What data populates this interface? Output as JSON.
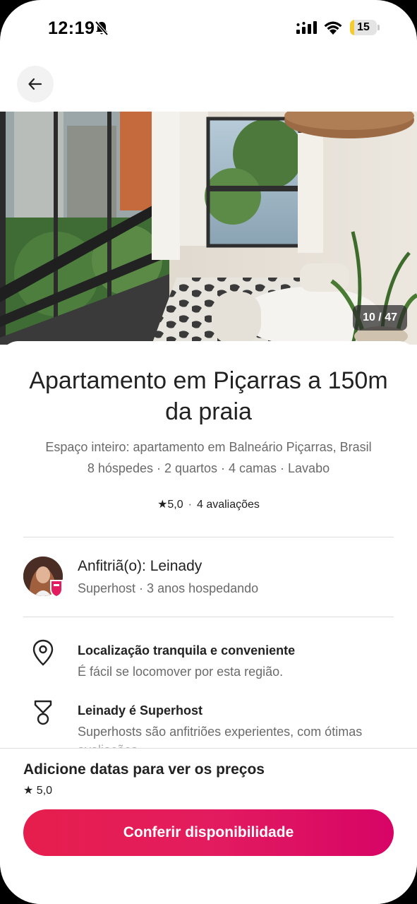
{
  "status_bar": {
    "time": "12:19",
    "battery_level": "15",
    "battery_fraction": 0.15,
    "icons": [
      "bell-off-icon",
      "signal-icon",
      "wifi-icon",
      "battery-icon"
    ]
  },
  "nav": {
    "back_icon": "arrow-left-icon"
  },
  "photo": {
    "counter": "10 / 47"
  },
  "listing": {
    "title": "Apartamento em Piçarras a 150m da praia",
    "subtitle_line1": "Espaço inteiro: apartamento em Balneário Piçarras, Brasil",
    "subtitle_line2": "8 hóspedes · 2 quartos · 4 camas · Lavabo",
    "rating": "5,0",
    "rating_separator": "·",
    "reviews": "4 avaliações"
  },
  "host": {
    "name": "Anfitriã(o): Leinady",
    "meta": "Superhost · 3 anos hospedando"
  },
  "features": [
    {
      "icon": "location-pin-icon",
      "title": "Localização tranquila e conveniente",
      "desc": "É fácil se locomover por esta região."
    },
    {
      "icon": "superhost-medal-icon",
      "title": "Leinady é Superhost",
      "desc": "Superhosts são anfitriões experientes, com ótimas",
      "desc_cont": "avaliações"
    }
  ],
  "booking": {
    "price_text": "Adicione datas para ver os preços",
    "rating": "5,0",
    "cta_label": "Conferir disponibilidade"
  },
  "colors": {
    "brand": "#e61e4d",
    "brand_end": "#d70466",
    "text_primary": "#222222",
    "text_secondary": "#6a6a6a"
  }
}
